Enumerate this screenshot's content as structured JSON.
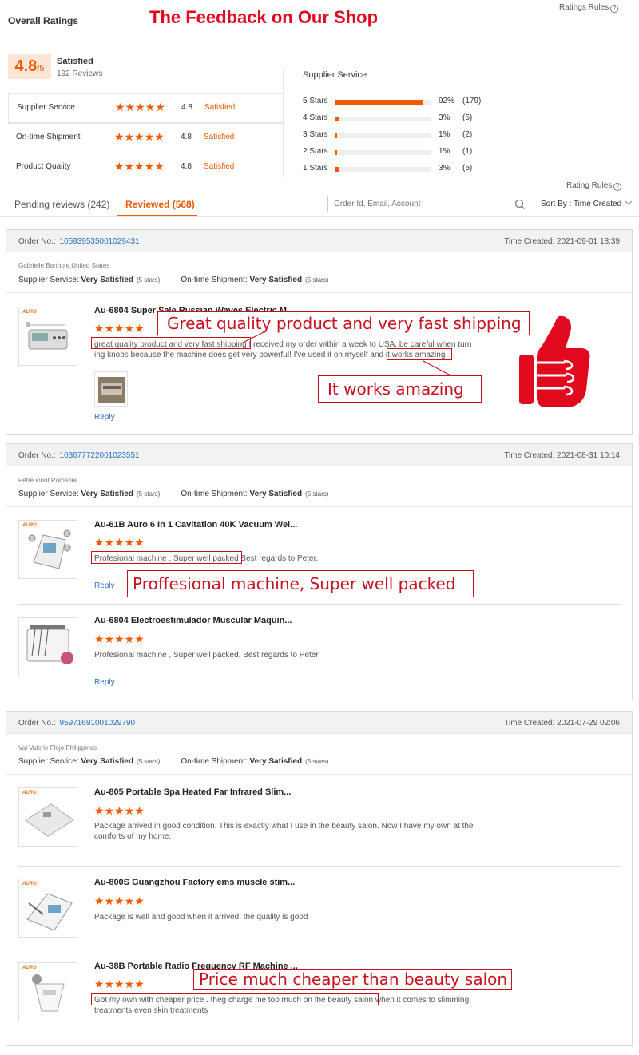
{
  "header": {
    "overall_title": "Overall Ratings",
    "banner_title": "The Feedback on Our Shop",
    "rules_label": "Ratings Rules"
  },
  "summary": {
    "score": "4.8",
    "score_suffix": "/5",
    "word": "Satisfied",
    "reviews": "192 Reviews",
    "metrics": [
      {
        "label": "Supplier Service",
        "stars": "★★★★★",
        "score": "4.8",
        "word": "Satisfied"
      },
      {
        "label": "On-time Shipment",
        "stars": "★★★★★",
        "score": "4.8",
        "word": "Satisfied"
      },
      {
        "label": "Product Quality",
        "stars": "★★★★★",
        "score": "4.8",
        "word": "Satisfied"
      }
    ]
  },
  "distribution": {
    "title": "Supplier Service",
    "rows": [
      {
        "label": "5 Stars",
        "fraction": 0.92,
        "pct": "92%",
        "count": "(179)"
      },
      {
        "label": "4 Stars",
        "fraction": 0.03,
        "pct": "3%",
        "count": "(5)"
      },
      {
        "label": "3 Stars",
        "fraction": 0.01,
        "pct": "1%",
        "count": "(2)"
      },
      {
        "label": "2 Stars",
        "fraction": 0.01,
        "pct": "1%",
        "count": "(1)"
      },
      {
        "label": "1 Stars",
        "fraction": 0.03,
        "pct": "3%",
        "count": "(5)"
      }
    ]
  },
  "tabs": {
    "rules_label": "Rating Rules",
    "pending": "Pending reviews (242)",
    "reviewed": "Reviewed (568)",
    "search_placeholder": "Order Id, Email, Account",
    "sort_label": "Sort By : Time Created"
  },
  "labels": {
    "order_no": "Order No.:",
    "time_created": "Time Created:",
    "supplier_service": "Supplier Service:",
    "ontime_shipment": "On-time Shipment:",
    "reply": "Reply",
    "brand": "AURO"
  },
  "orders": [
    {
      "order_no": "105939535001029431",
      "time": "2021-09-01 18:39",
      "buyer": "Gabrielle Barthole,United States",
      "supplier_rating": "Very Satisfied",
      "supplier_stars": "(5 stars)",
      "shipment_rating": "Very Satisfied",
      "shipment_stars": "(5 stars)",
      "items": [
        {
          "title": "Au-6804 Super Sale Russian Waves Electric M...",
          "stars": "★★★★★",
          "text_hl": "great quality product and very fast shipping",
          "text_1": " I received my order within a week to USA. be careful when turn",
          "text_2": "ing knobs because the machine does get very powerful! I've used it on myself and ",
          "text_hl2": "it works amazing"
        }
      ]
    },
    {
      "order_no": "103677722001023551",
      "time": "2021-08-31 10:14",
      "buyer": "Petre ionut,Romania",
      "supplier_rating": "Very Satisfied",
      "supplier_stars": "(5 stars)",
      "shipment_rating": "Very Satisfied",
      "shipment_stars": "(5 stars)",
      "items": [
        {
          "title": "Au-61B Auro 6 In 1 Cavitation 40K Vacuum Wei...",
          "stars": "★★★★★",
          "text_hl": "Profesional machine , Super well packed",
          "text_1": " Best regards to Peter."
        },
        {
          "title": "Au-6804 Electroestimulador Muscular Maquin...",
          "stars": "★★★★★",
          "text_1": "Profesional machine , Super well packed, Best regards to Peter."
        }
      ]
    },
    {
      "order_no": "95971691001029790",
      "time": "2021-07-29 02:06",
      "buyer": "Val Valerie Flojo,Philippines",
      "supplier_rating": "Very Satisfied",
      "supplier_stars": "(5 stars)",
      "shipment_rating": "Very Satisfied",
      "shipment_stars": "(5 stars)",
      "items": [
        {
          "title": "Au-805 Portable Spa Heated Far Infrared Slim...",
          "stars": "★★★★★",
          "text_1": "Package arrived in good condition. This is exactly what I use in the beauty salon. Now I have my own at the",
          "text_2": "comforts of my home."
        },
        {
          "title": "Au-800S Guangzhou Factory ems muscle stim...",
          "stars": "★★★★★",
          "text_1": "Package is well and good when it arrived. the quality is good"
        },
        {
          "title": "Au-38B Portable Radio Frequency RF Machine ...",
          "stars": "★★★★★",
          "text_hl": "Got my own with cheaper price . theg charge me too much on the beauty salon",
          "text_1": " when it comes to slimming",
          "text_2": "treatments even skin treatments"
        }
      ]
    }
  ],
  "annotations": {
    "callout_1": "Great quality product and very fast shipping",
    "callout_2": "It  works amazing",
    "callout_3": "Proffesional machine, Super well packed",
    "callout_4": "Price much cheaper than beauty salon"
  },
  "colors": {
    "accent": "#f05a00",
    "banner": "#e0091e",
    "link": "#2a72c7",
    "annotation": "#c8101f"
  }
}
